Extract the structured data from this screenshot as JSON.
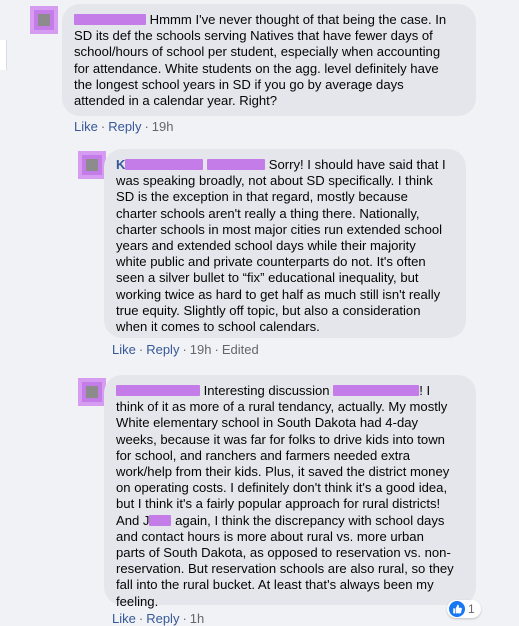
{
  "comments": [
    {
      "lines": [
        "Hmmm I've never thought of that being the case. In",
        "SD its def the schools serving Natives that have fewer days of",
        "school/hours of school per student, especially when accounting",
        "for attendance. White students on the agg. level definitely have",
        "the longest school years in SD if you go by average days",
        "attended in a calendar year. Right?"
      ],
      "actions": {
        "like": "Like",
        "reply": "Reply",
        "time": "19h"
      }
    },
    {
      "name_partial_a": "K",
      "name_partial_b": "",
      "lines": [
        "Sorry! I should have said that I",
        "was speaking broadly, not about SD specifically. I think",
        "SD is the exception in that regard, mostly because",
        "charter schools aren't really a thing there. Nationally,",
        "charter schools in most major cities run extended school",
        "years and extended school days while their majority",
        "white public and private counterparts do not. It's often",
        "seen a silver bullet to “fix” educational inequality, but",
        "working twice as hard to get half as much still isn't really",
        "true equity. Slightly off topic, but also a consideration",
        "when it comes to school calendars."
      ],
      "actions": {
        "like": "Like",
        "reply": "Reply",
        "time": "19h",
        "edited": "Edited"
      }
    },
    {
      "line1_a": "Interesting discussion",
      "line1_b": "! I",
      "lines": [
        "think of it as more of a rural tendancy, actually. My mostly",
        "White elementary school in South Dakota had 4-day",
        "weeks, because it was far for folks to drive kids into town",
        "for school, and ranchers and farmers needed extra",
        "work/help from their kids. Plus, it saved the district money",
        "on operating costs. I definitely don't think it's a good idea,",
        "but I think it's a fairly popular approach for rural districts!"
      ],
      "line_and_a": "And J",
      "line_and_b": "again, I think the discrepancy with school days",
      "lines_after": [
        "and contact hours is more about rural vs. more urban",
        "parts of South Dakota, as opposed to reservation vs. non-",
        "reservation. But reservation schools are also rural, so they",
        "fall into the rural bucket. At least that's always been my",
        "feeling."
      ],
      "actions": {
        "like": "Like",
        "reply": "Reply",
        "time": "1h"
      },
      "reaction_count": "1"
    }
  ],
  "colors": {
    "redaction": "#c47de8",
    "bubble": "#e4e6eb",
    "link": "#385898",
    "like_blue": "#1877f2"
  }
}
